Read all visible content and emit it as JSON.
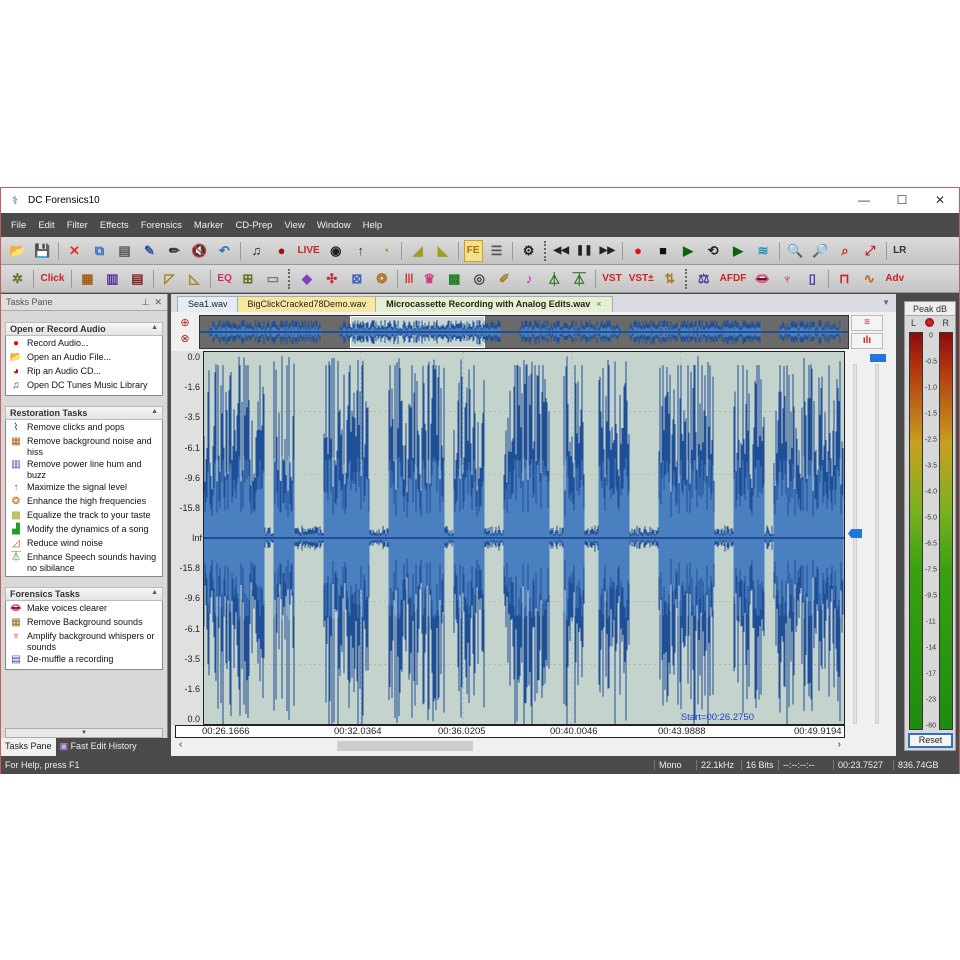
{
  "window": {
    "title": "DC Forensics10",
    "controls": {
      "minimize": "—",
      "maximize": "☐",
      "close": "✕"
    }
  },
  "menu": [
    "File",
    "Edit",
    "Filter",
    "Effects",
    "Forensics",
    "Marker",
    "CD-Prep",
    "View",
    "Window",
    "Help"
  ],
  "toolbar1": [
    {
      "name": "open-icon",
      "glyph": "📂"
    },
    {
      "name": "save-icon",
      "glyph": "💾"
    },
    {
      "sep": true
    },
    {
      "name": "delete-icon",
      "glyph": "✕",
      "color": "#e03020"
    },
    {
      "name": "copy-icon",
      "glyph": "⧉",
      "color": "#3070c0"
    },
    {
      "name": "paste-icon",
      "glyph": "▤",
      "color": "#555"
    },
    {
      "name": "draw-wave-icon",
      "glyph": "✎",
      "color": "#3050a0"
    },
    {
      "name": "pencil-icon",
      "glyph": "✏",
      "color": "#333"
    },
    {
      "name": "mute-icon",
      "glyph": "🔇",
      "color": "#333"
    },
    {
      "name": "undo-icon",
      "glyph": "↶",
      "color": "#3070c0"
    },
    {
      "sep": true
    },
    {
      "name": "music-library-icon",
      "glyph": "♫",
      "color": "#222"
    },
    {
      "name": "rip-cd-icon",
      "glyph": "●",
      "color": "#a01010"
    },
    {
      "name": "live-icon",
      "glyph": "LIVE",
      "color": "#d02020",
      "text": true
    },
    {
      "name": "vinyl-icon",
      "glyph": "◉",
      "color": "#222"
    },
    {
      "name": "maximize-level-icon",
      "glyph": "↑",
      "color": "#333"
    },
    {
      "name": "clock-icon",
      "glyph": "◔",
      "color": "#b09010"
    },
    {
      "sep": true
    },
    {
      "name": "fade-in-icon",
      "glyph": "◢",
      "color": "#a0a020"
    },
    {
      "name": "fade-out-icon",
      "glyph": "◣",
      "color": "#a0a020"
    },
    {
      "sep": true
    },
    {
      "name": "fast-edit-icon",
      "glyph": "FE",
      "color": "#b07010",
      "text": true,
      "highlight": true
    },
    {
      "name": "split-view-icon",
      "glyph": "☰",
      "color": "#555"
    },
    {
      "sep": true
    },
    {
      "name": "settings-gear-icon",
      "glyph": "⚙",
      "color": "#222"
    },
    {
      "grip": true
    },
    {
      "name": "rewind-icon",
      "glyph": "◀◀",
      "color": "#222",
      "text": true
    },
    {
      "name": "pause-icon",
      "glyph": "❚❚",
      "color": "#222",
      "text": true
    },
    {
      "name": "fast-forward-icon",
      "glyph": "▶▶",
      "color": "#222",
      "text": true
    },
    {
      "sep": true
    },
    {
      "name": "record-icon",
      "glyph": "●",
      "color": "#e01010"
    },
    {
      "name": "stop-icon",
      "glyph": "■",
      "color": "#111"
    },
    {
      "name": "play-icon",
      "glyph": "▶",
      "color": "#106010"
    },
    {
      "name": "loop-icon",
      "glyph": "⟲",
      "color": "#222"
    },
    {
      "name": "play-from-icon",
      "glyph": "▶",
      "color": "#106010"
    },
    {
      "name": "spectrum-icon",
      "glyph": "≋",
      "color": "#2090c0"
    },
    {
      "sep": true
    },
    {
      "name": "zoom-in-icon",
      "glyph": "🔍",
      "color": "#555"
    },
    {
      "name": "zoom-out-icon",
      "glyph": "🔎",
      "color": "#555"
    },
    {
      "name": "zoom-selection-icon",
      "glyph": "⌕",
      "color": "#c02020"
    },
    {
      "name": "zoom-fit-icon",
      "glyph": "⤢",
      "color": "#c02020"
    },
    {
      "sep": true
    },
    {
      "name": "left-right-channel-icon",
      "glyph": "LR",
      "color": "#333",
      "text": true
    }
  ],
  "toolbar2": [
    {
      "name": "noise-map-icon",
      "glyph": "✲",
      "color": "#607020"
    },
    {
      "sep": true
    },
    {
      "name": "click-removal-icon",
      "glyph": "Click",
      "color": "#d02020",
      "text": true
    },
    {
      "sep": true
    },
    {
      "name": "noise-reduction-icon",
      "glyph": "▦",
      "color": "#a06010"
    },
    {
      "name": "hum-removal-icon",
      "glyph": "▥",
      "color": "#5030a0"
    },
    {
      "name": "dynamics-icon",
      "glyph": "▤",
      "color": "#802020"
    },
    {
      "sep": true
    },
    {
      "name": "eq-graph-icon",
      "glyph": "◸",
      "color": "#a08010"
    },
    {
      "name": "wind-icon",
      "glyph": "◺",
      "color": "#a08010"
    },
    {
      "sep": true
    },
    {
      "name": "equalizer-icon",
      "glyph": "EQ",
      "color": "#e02070",
      "text": true
    },
    {
      "name": "routing-icon",
      "glyph": "⊞",
      "color": "#607020"
    },
    {
      "name": "compare-icon",
      "glyph": "▭",
      "color": "#777"
    },
    {
      "grip": true
    },
    {
      "name": "effect-purple-icon",
      "glyph": "◆",
      "color": "#8040c0"
    },
    {
      "name": "effect-scatter-icon",
      "glyph": "✣",
      "color": "#c03040"
    },
    {
      "name": "effect-graph-icon",
      "glyph": "⊠",
      "color": "#4060c0"
    },
    {
      "name": "effect-enhance-icon",
      "glyph": "❂",
      "color": "#b07020"
    },
    {
      "sep": true
    },
    {
      "name": "level-bars-icon",
      "glyph": "|||",
      "color": "#d02020",
      "text": true
    },
    {
      "name": "trophy-icon",
      "glyph": "♛",
      "color": "#d04080"
    },
    {
      "name": "spectrogram-icon",
      "glyph": "▩",
      "color": "#208020"
    },
    {
      "name": "cd-icon",
      "glyph": "◎",
      "color": "#444"
    },
    {
      "name": "brush-icon",
      "glyph": "✐",
      "color": "#a08020"
    },
    {
      "name": "music-note-icon",
      "glyph": "♪",
      "color": "#c020c0"
    },
    {
      "name": "filter-trapezoid-icon",
      "glyph": "⏃",
      "color": "#207020"
    },
    {
      "name": "speech-filter-icon",
      "glyph": "⏄",
      "color": "#207020"
    },
    {
      "sep": true
    },
    {
      "name": "vst-icon",
      "glyph": "VST",
      "color": "#d02020",
      "text": true
    },
    {
      "name": "vst-chain-icon",
      "glyph": "VST±",
      "color": "#d02020",
      "text": true
    },
    {
      "name": "swap-icon",
      "glyph": "⇅",
      "color": "#a08020"
    },
    {
      "grip": true
    },
    {
      "name": "balance-icon",
      "glyph": "⚖",
      "color": "#5030a0"
    },
    {
      "name": "afdf-icon",
      "glyph": "AFDF",
      "color": "#d02020",
      "text": true
    },
    {
      "name": "lips-icon",
      "glyph": "👄",
      "color": "#e02020"
    },
    {
      "name": "whisper-amplify-icon",
      "glyph": "♆",
      "color": "#d02020"
    },
    {
      "name": "phone-icon",
      "glyph": "▯",
      "color": "#5030a0"
    },
    {
      "sep": true
    },
    {
      "name": "square-wave-icon",
      "glyph": "⊓",
      "color": "#d02020"
    },
    {
      "name": "sine-wave-icon",
      "glyph": "∿",
      "color": "#c06010"
    },
    {
      "name": "advanced-icon",
      "glyph": "Adv",
      "color": "#d02020",
      "text": true
    }
  ],
  "tasks_pane": {
    "title": "Tasks Pane",
    "groups": [
      {
        "title": "Open or Record Audio",
        "items": [
          {
            "label": "Record Audio...",
            "icon": "record-icon",
            "glyph": "●",
            "color": "#e01010"
          },
          {
            "label": "Open an Audio File...",
            "icon": "folder-open-icon",
            "glyph": "📂",
            "color": "#c09020"
          },
          {
            "label": "Rip an Audio CD...",
            "icon": "rip-cd-icon",
            "glyph": "◕",
            "color": "#a01010"
          },
          {
            "label": "Open DC Tunes Music Library",
            "icon": "music-library-icon",
            "glyph": "♫",
            "color": "#2030a0"
          }
        ]
      },
      {
        "title": "Restoration Tasks",
        "items": [
          {
            "label": "Remove clicks and pops",
            "icon": "click-icon",
            "glyph": "⌇",
            "color": "#2040a0"
          },
          {
            "label": "Remove background noise and hiss",
            "icon": "noise-icon",
            "glyph": "▦",
            "color": "#a06010"
          },
          {
            "label": "Remove power line hum and buzz",
            "icon": "hum-icon",
            "glyph": "▥",
            "color": "#5030a0"
          },
          {
            "label": "Maximize the signal level",
            "icon": "maximize-icon",
            "glyph": "↑",
            "color": "#806010"
          },
          {
            "label": "Enhance the high frequencies",
            "icon": "enhance-icon",
            "glyph": "❂",
            "color": "#b07020"
          },
          {
            "label": "Equalize the track to your taste",
            "icon": "eq-icon",
            "glyph": "▩",
            "color": "#a0a020"
          },
          {
            "label": "Modify the dynamics of a song",
            "icon": "dynamics-icon",
            "glyph": "▟",
            "color": "#20a020"
          },
          {
            "label": "Reduce wind noise",
            "icon": "wind-icon",
            "glyph": "◿",
            "color": "#a06010"
          },
          {
            "label": "Enhance Speech sounds having no sibilance",
            "icon": "speech-icon",
            "glyph": "⏄",
            "color": "#207020"
          }
        ]
      },
      {
        "title": "Forensics Tasks",
        "items": [
          {
            "label": "Make voices clearer",
            "icon": "lips-icon",
            "glyph": "👄",
            "color": "#e02020"
          },
          {
            "label": "Remove Background sounds",
            "icon": "background-noise-icon",
            "glyph": "▦",
            "color": "#a06010"
          },
          {
            "label": "Amplify background whispers or sounds",
            "icon": "whisper-icon",
            "glyph": "♆",
            "color": "#d02020"
          },
          {
            "label": "De-muffle a recording",
            "icon": "demuffle-icon",
            "glyph": "▤",
            "color": "#4040a0"
          }
        ]
      }
    ],
    "bottom_tabs": [
      "Tasks Pane",
      "Fast Edit History"
    ]
  },
  "editor": {
    "tabs": [
      {
        "label": "Sea1.wav",
        "active": false
      },
      {
        "label": "BigClickCracked78Demo.wav",
        "active": false
      },
      {
        "label": "Microcassette Recording with Analog Edits.wav",
        "active": true,
        "close": "×"
      }
    ],
    "y_axis_labels": [
      "0.0",
      "-1.6",
      "-3.5",
      "-6.1",
      "-9.6",
      "-15.8",
      "Inf",
      "-15.8",
      "-9.6",
      "-6.1",
      "-3.5",
      "-1.6",
      "0.0"
    ],
    "start_label": "Start=00:26.2750",
    "time_labels": [
      "00:26.1666",
      "00:32.0364",
      "00:36.0205",
      "00:40.0046",
      "00:43.9888",
      "00:49.9194"
    ],
    "channel": "Mono",
    "color_wave": "#1f4f96",
    "color_wave_light": "#4a7fc0",
    "color_plot_bg": "#c5d3cd"
  },
  "peak_meter": {
    "title": "Peak dB",
    "left_label": "L",
    "right_label": "R",
    "scale": [
      "0",
      "-0.5",
      "-1.0",
      "-1.5",
      "-2.5",
      "-3.5",
      "-4.0",
      "-5.0",
      "-6.5",
      "-7.5",
      "-9.5",
      "-11",
      "-14",
      "-17",
      "-23",
      "-60"
    ],
    "reset_label": "Reset"
  },
  "status": {
    "help": "For Help, press F1",
    "channels": "Mono",
    "sample_rate": "22.1kHz",
    "bits": "16 Bits",
    "position": "--:--:--:--",
    "duration": "00:23.7527",
    "free_space": "836.74GB"
  }
}
